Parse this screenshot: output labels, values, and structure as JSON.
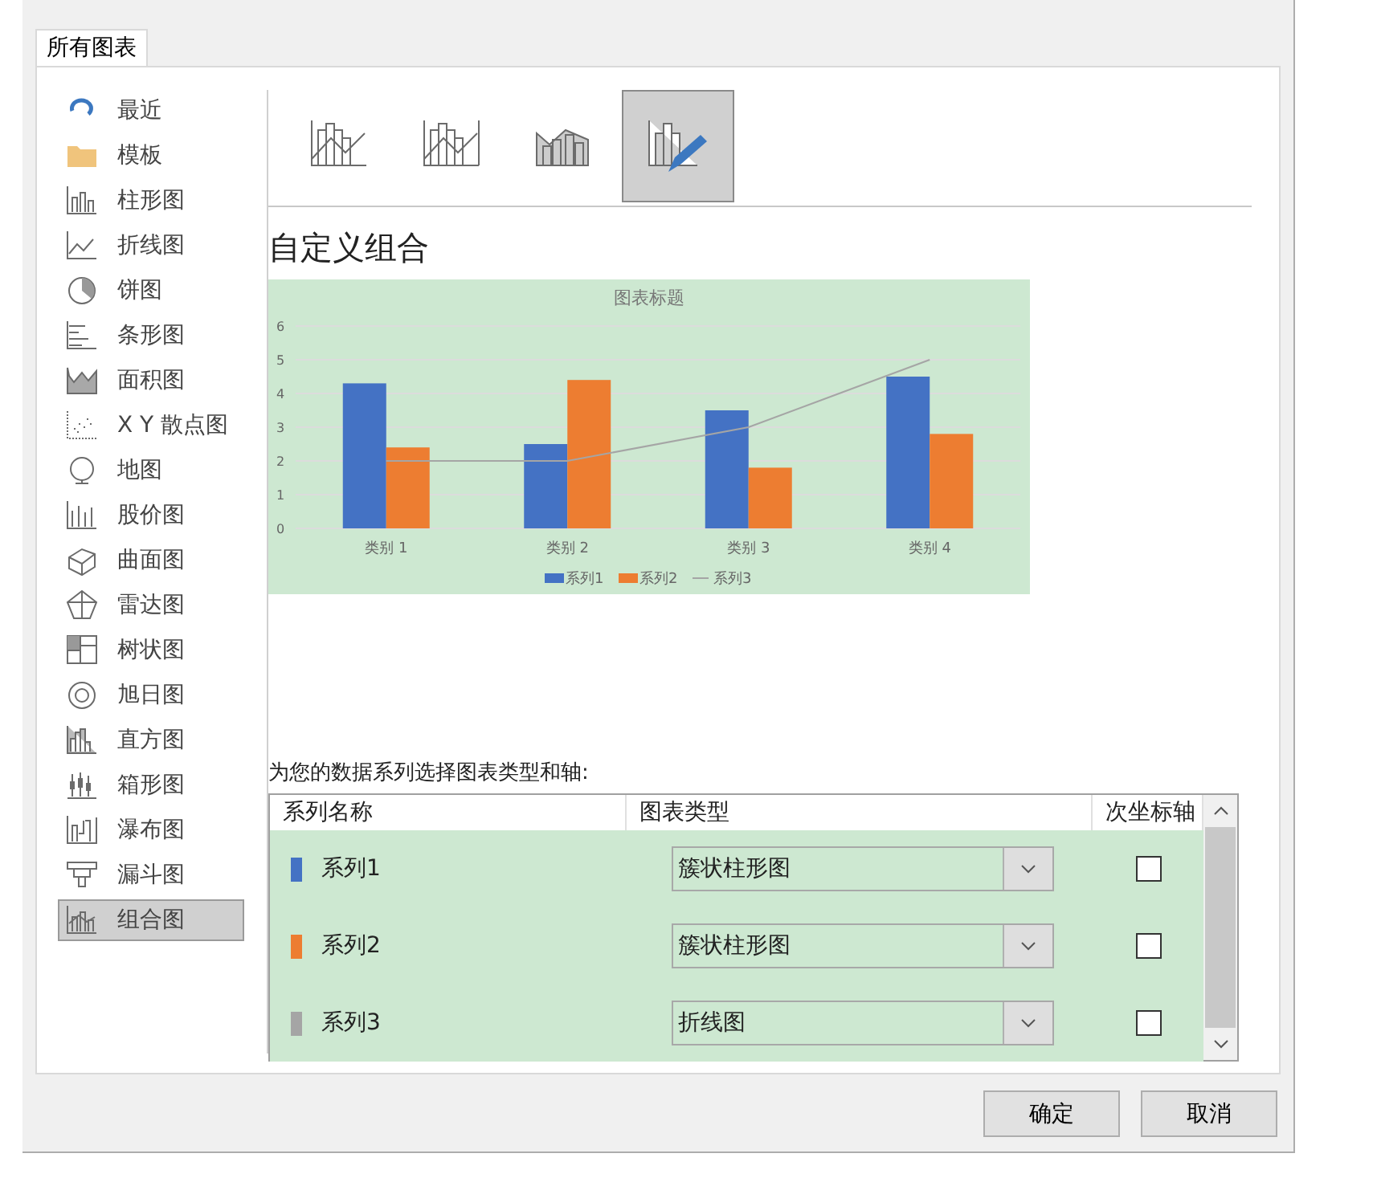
{
  "tabs": [
    {
      "label": "所有图表",
      "selected": true
    }
  ],
  "sidebar": {
    "items": [
      {
        "label": "最近",
        "selected": false
      },
      {
        "label": "模板",
        "selected": false
      },
      {
        "label": "柱形图",
        "selected": false
      },
      {
        "label": "折线图",
        "selected": false
      },
      {
        "label": "饼图",
        "selected": false
      },
      {
        "label": "条形图",
        "selected": false
      },
      {
        "label": "面积图",
        "selected": false
      },
      {
        "label": "X Y 散点图",
        "selected": false
      },
      {
        "label": "地图",
        "selected": false
      },
      {
        "label": "股价图",
        "selected": false
      },
      {
        "label": "曲面图",
        "selected": false
      },
      {
        "label": "雷达图",
        "selected": false
      },
      {
        "label": "树状图",
        "selected": false
      },
      {
        "label": "旭日图",
        "selected": false
      },
      {
        "label": "直方图",
        "selected": false
      },
      {
        "label": "箱形图",
        "selected": false
      },
      {
        "label": "瀑布图",
        "selected": false
      },
      {
        "label": "漏斗图",
        "selected": false
      },
      {
        "label": "组合图",
        "selected": true
      }
    ]
  },
  "subtypes": [
    {
      "selected": false
    },
    {
      "selected": false
    },
    {
      "selected": false
    },
    {
      "selected": true
    }
  ],
  "heading": "自定义组合",
  "preview": {
    "chart_data": {
      "type": "bar",
      "title": "图表标题",
      "categories": [
        "类别 1",
        "类别 2",
        "类别 3",
        "类别 4"
      ],
      "series": [
        {
          "name": "系列1",
          "color": "#4472c4",
          "values": [
            4.3,
            2.5,
            3.5,
            4.5
          ]
        },
        {
          "name": "系列2",
          "color": "#ed7d31",
          "values": [
            2.4,
            4.4,
            1.8,
            2.8
          ]
        },
        {
          "name": "系列3",
          "color": "#a5a5a5",
          "values": [
            2,
            2,
            3,
            5
          ],
          "type": "line"
        }
      ],
      "ylim": [
        0,
        6
      ],
      "yticks": [
        0,
        1,
        2,
        3,
        4,
        5,
        6
      ],
      "grid": true,
      "legend": "bottom"
    }
  },
  "series_prompt": "为您的数据系列选择图表类型和轴:",
  "series_table": {
    "columns": [
      "系列名称",
      "图表类型",
      "次坐标轴"
    ],
    "rows": [
      {
        "name": "系列1",
        "color": "#4472c4",
        "chart_type": "簇状柱形图",
        "secondary_axis": false
      },
      {
        "name": "系列2",
        "color": "#ed7d31",
        "chart_type": "簇状柱形图",
        "secondary_axis": false
      },
      {
        "name": "系列3",
        "color": "#a5a5a5",
        "chart_type": "折线图",
        "secondary_axis": false
      }
    ]
  },
  "buttons": [
    "确定",
    "取消"
  ]
}
